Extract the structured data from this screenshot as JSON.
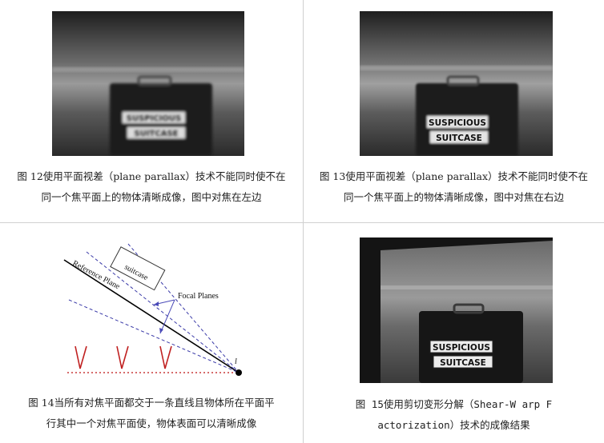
{
  "figures": [
    {
      "caption_line1": "图 12使用平面视差（plane parallax）技术不能同时使不在",
      "caption_line2": "同一个焦平面上的物体清晰成像，图中对焦在左边",
      "sign_top": "SUSPICIOUS",
      "sign_bottom": "SUITCASE"
    },
    {
      "caption_line1": "图 13使用平面视差（plane parallax）技术不能同时使不在",
      "caption_line2": "同一个焦平面上的物体清晰成像，图中对焦在右边",
      "sign_top": "SUSPICIOUS",
      "sign_bottom": "SUITCASE"
    },
    {
      "caption_line1": "图 14当所有对焦平面都交于一条直线且物体所在平面平",
      "caption_line2": "行其中一个对焦平面使，物体表面可以清晰成像",
      "diagram_ref_label": "Reference Plane",
      "diagram_focal_label": "Focal Planes",
      "diagram_box_label": "suitcase",
      "diagram_point_label": "l"
    },
    {
      "caption_line1": "图 15使用剪切变形分解（Shear-W arp F",
      "caption_line2": "actorization）技术的成像结果",
      "sign_top": "SUSPICIOUS",
      "sign_bottom": "SUITCASE"
    }
  ]
}
